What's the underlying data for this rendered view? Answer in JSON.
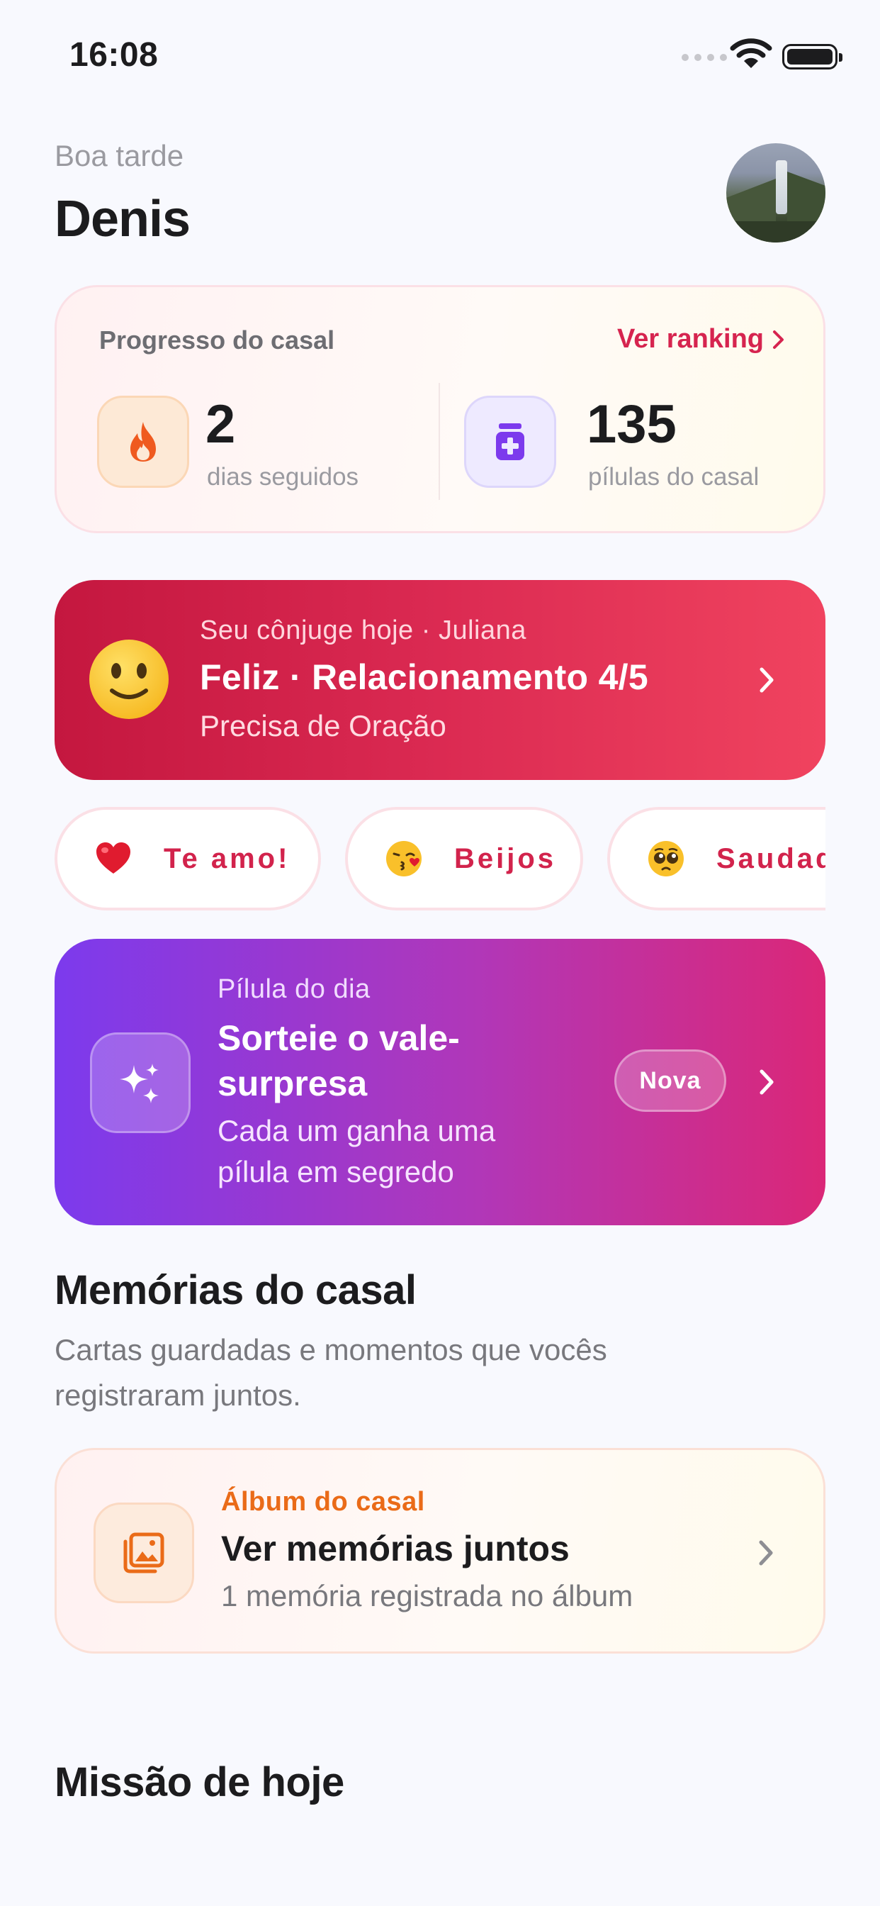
{
  "status_bar": {
    "time": "16:08"
  },
  "header": {
    "greeting": "Boa tarde",
    "user_name": "Denis"
  },
  "progress": {
    "title": "Progresso do casal",
    "ranking_link": "Ver ranking",
    "streak_value": "2",
    "streak_label": "dias seguidos",
    "pills_value": "135",
    "pills_label": "pílulas do casal"
  },
  "spouse": {
    "subtitle": "Seu cônjuge hoje · Juliana",
    "title": "Feliz · Relacionamento 4/5",
    "description": "Precisa de Oração"
  },
  "quick_messages": [
    {
      "icon": "heart-icon",
      "label": "Te amo!"
    },
    {
      "icon": "kiss-face-icon",
      "label": "Beijos"
    },
    {
      "icon": "pleading-face-icon",
      "label": "Saudades"
    }
  ],
  "daily_pill": {
    "subtitle": "Pílula do dia",
    "title": "Sorteie o vale-surpresa",
    "description": "Cada um ganha uma pílula em segredo",
    "badge": "Nova"
  },
  "memories": {
    "title": "Memórias do casal",
    "description": "Cartas guardadas e momentos que vocês registraram juntos.",
    "album_subtitle": "Álbum do casal",
    "album_title": "Ver memórias juntos",
    "album_description": "1 memória registrada no álbum"
  },
  "mission": {
    "title": "Missão de hoje"
  },
  "colors": {
    "accent_red": "#d6244f",
    "spouse_gradient": [
      "#c4173f",
      "#f0435f"
    ],
    "daily_gradient": [
      "#7c3aed",
      "#db2777"
    ],
    "album_accent": "#ea6b18",
    "background": "#f8f9fe"
  }
}
